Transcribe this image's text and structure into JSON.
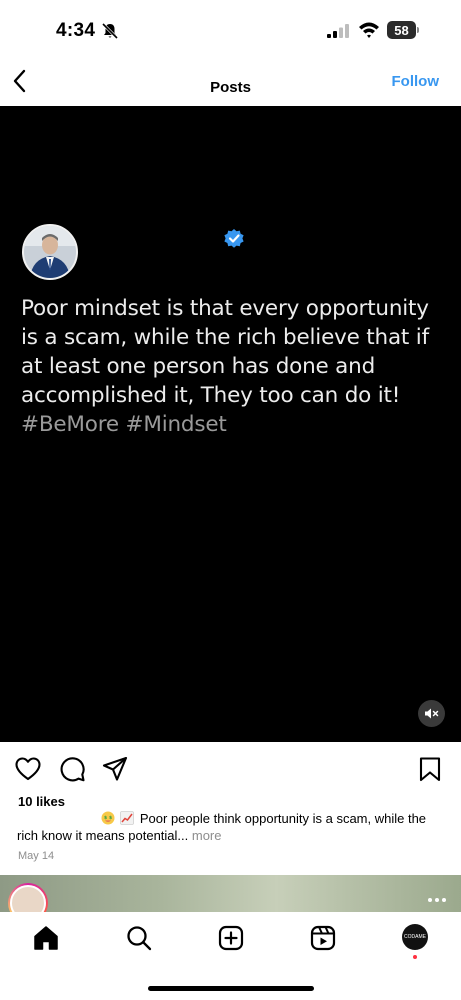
{
  "status_bar": {
    "time": "4:34",
    "battery": "58"
  },
  "header": {
    "title": "Posts",
    "follow_label": "Follow"
  },
  "post": {
    "quote": "Poor mindset is that every opportunity is a scam, while the rich believe that if at least one person has done and accomplished it, They too can do it!",
    "hashtags": "#BeMore #Mindset",
    "likes": "10 likes",
    "caption": "Poor people think opportunity is a scam, while the rich know it means potential...",
    "more_label": "more",
    "date": "May 14"
  },
  "tabs": [
    {
      "name": "home",
      "icon": "home-icon"
    },
    {
      "name": "search",
      "icon": "search-icon"
    },
    {
      "name": "create",
      "icon": "plus-square-icon"
    },
    {
      "name": "reels",
      "icon": "reels-icon"
    },
    {
      "name": "profile",
      "icon": "avatar"
    }
  ],
  "profile_tab_label": "CODAME",
  "colors": {
    "follow": "#3897f0",
    "verified": "#3897f0",
    "notification_dot": "#ff3040"
  }
}
